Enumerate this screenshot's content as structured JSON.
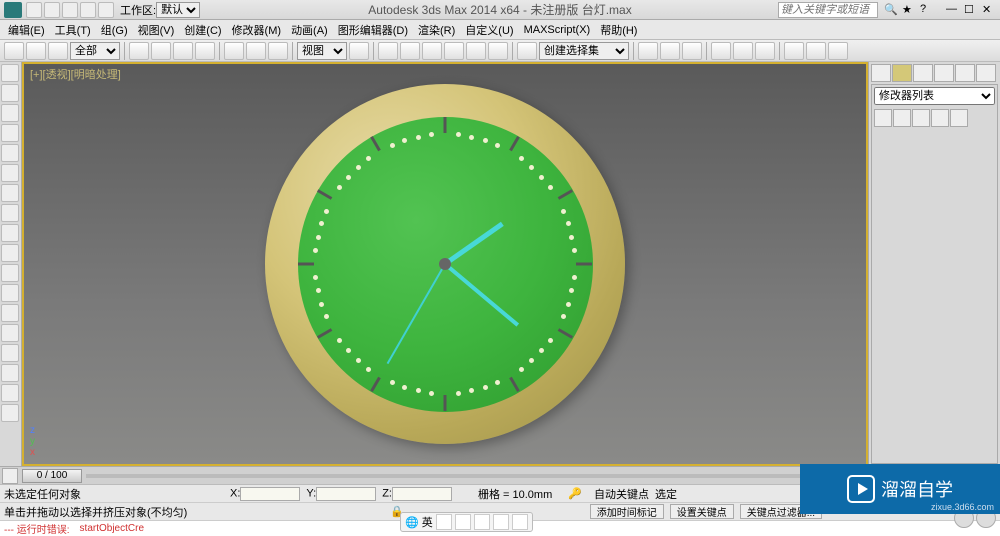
{
  "title": "Autodesk 3ds Max  2014 x64   - 未注册版    台灯.max",
  "workspace": {
    "label": "工作区:",
    "value": "默认"
  },
  "search_placeholder": "键入关键字或短语",
  "menu": [
    "编辑(E)",
    "工具(T)",
    "组(G)",
    "视图(V)",
    "创建(C)",
    "修改器(M)",
    "动画(A)",
    "图形编辑器(D)",
    "渲染(R)",
    "自定义(U)",
    "MAXScript(X)",
    "帮助(H)"
  ],
  "toolbar": {
    "all": "全部",
    "view_label": "视图",
    "create_set": "创建选择集"
  },
  "viewport_label": "[+][透视][明暗处理]",
  "modifier_list": "修改器列表",
  "timeline_thumb": "0 / 100",
  "status": {
    "no_select": "未选定任何对象",
    "hint": "单击并拖动以选择并挤压对象(不均匀)",
    "grid": "栅格 = 10.0mm",
    "auto_key": "自动关键点",
    "set_key": "设置关键点",
    "selected": "选定",
    "add_time": "添加时间标记",
    "key_filter": "关键点过滤器..."
  },
  "error": {
    "label": "--- 运行时错误:",
    "text": "startObjectCre"
  },
  "ime": "英",
  "watermark": {
    "brand": "溜溜自学",
    "url": "zixue.3d66.com"
  }
}
